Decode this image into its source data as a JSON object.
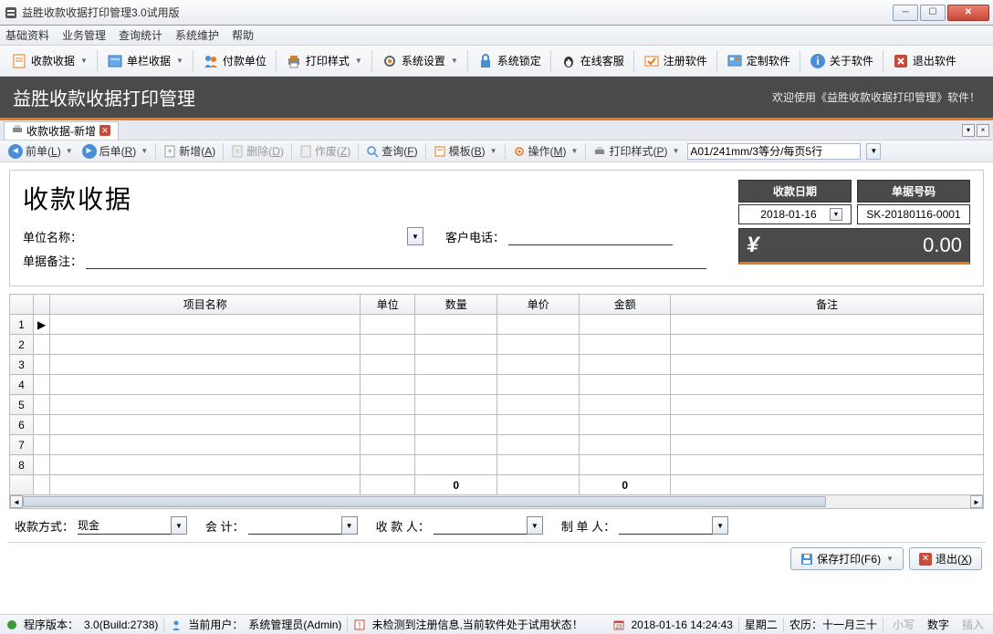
{
  "titlebar": {
    "title": "益胜收款收据打印管理3.0试用版"
  },
  "menubar": [
    "基础资料",
    "业务管理",
    "查询统计",
    "系统维护",
    "帮助"
  ],
  "toolbar": {
    "receipt": "收款收据",
    "single": "单栏收据",
    "payer": "付款单位",
    "printstyle": "打印样式",
    "sysset": "系统设置",
    "syslock": "系统锁定",
    "service": "在线客服",
    "register": "注册软件",
    "custom": "定制软件",
    "about": "关于软件",
    "exit": "退出软件"
  },
  "header": {
    "app_title": "益胜收款收据打印管理",
    "welcome": "欢迎使用《益胜收款收据打印管理》软件！"
  },
  "tab": {
    "label": "收款收据-新增"
  },
  "subtoolbar": {
    "prev": "前单(L)",
    "next": "后单(R)",
    "add": "新增(A)",
    "delete": "删除(D)",
    "void": "作废(Z)",
    "query": "查询(F)",
    "template": "模板(B)",
    "operate": "操作(M)",
    "printstyle": "打印样式(P)",
    "print_select": "A01/241mm/3等分/每页5行"
  },
  "doc": {
    "title": "收款收据",
    "company_label": "单位名称：",
    "phone_label": "客户电话：",
    "remark_label": "单据备注：",
    "date_header": "收款日期",
    "number_header": "单据号码",
    "date_value": "2018-01-16",
    "number_value": "SK-20180116-0001",
    "amount": "0.00"
  },
  "grid": {
    "headers": [
      "项目名称",
      "单位",
      "数量",
      "单价",
      "金额",
      "备注"
    ],
    "rows": 8,
    "sum_qty": "0",
    "sum_amt": "0"
  },
  "bottom": {
    "paytype_label": "收款方式：",
    "paytype_value": "现金",
    "acct_label": "会 计：",
    "recv_label": "收 款 人：",
    "maker_label": "制 单 人："
  },
  "actions": {
    "save_print": "保存打印(F6)",
    "exit": "退出(X)"
  },
  "status": {
    "version_label": "程序版本：",
    "version": "3.0(Build:2738)",
    "user_label": "当前用户：",
    "user": "系统管理员(Admin)",
    "reg": "未检测到注册信息,当前软件处于试用状态！",
    "datetime": "2018-01-16 14:24:43",
    "weekday": "星期二",
    "lunar": "农历：十一月三十",
    "caps": "小写",
    "num": "数字",
    "ins": "插入"
  }
}
